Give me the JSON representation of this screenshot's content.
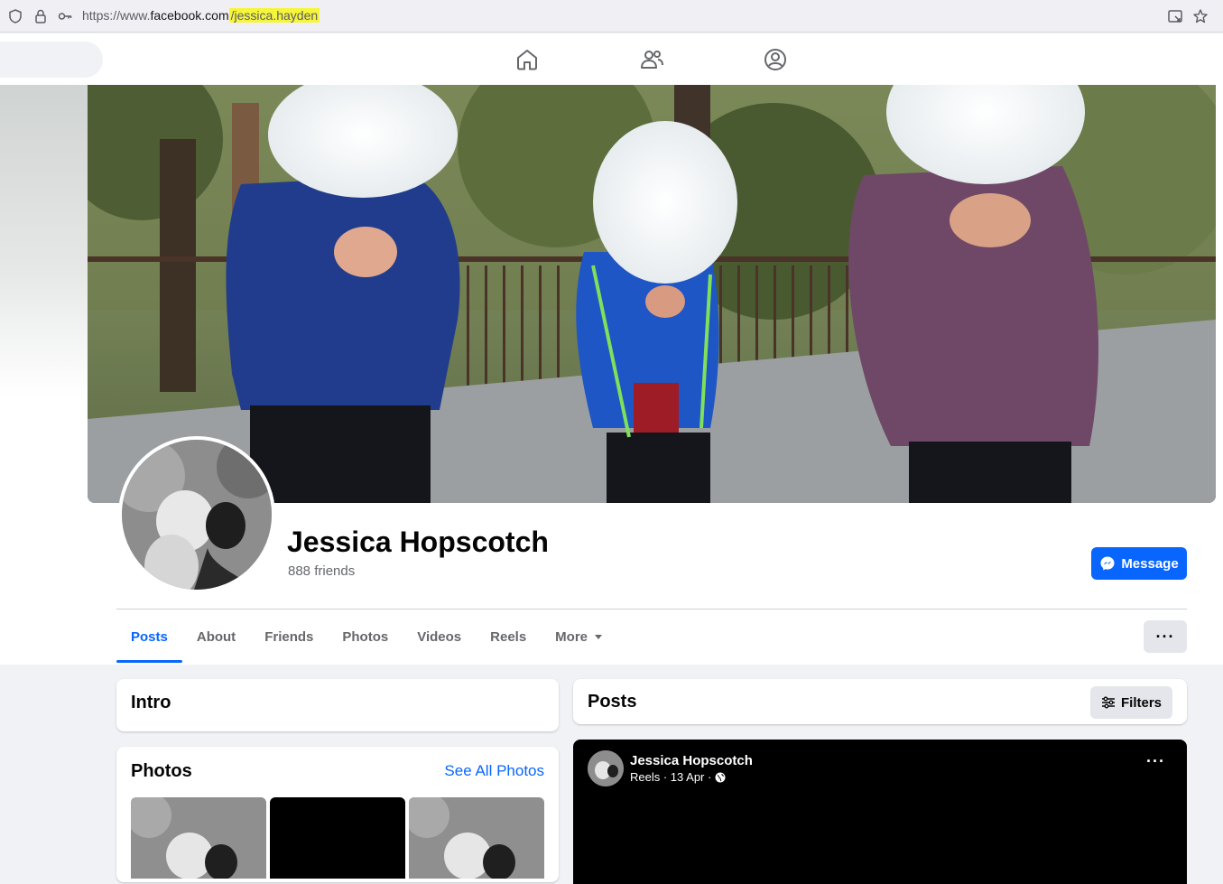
{
  "browser": {
    "url_scheme": "https://www.",
    "url_domain": "facebook.com",
    "url_path": "/jessica.hayden"
  },
  "nav": {
    "icons": [
      "home-icon",
      "friends-icon",
      "profile-icon"
    ]
  },
  "profile": {
    "name": "Jessica Hopscotch",
    "friends": "888 friends",
    "message_label": "Message"
  },
  "tabs": [
    {
      "label": "Posts",
      "active": true
    },
    {
      "label": "About"
    },
    {
      "label": "Friends"
    },
    {
      "label": "Photos"
    },
    {
      "label": "Videos"
    },
    {
      "label": "Reels"
    },
    {
      "label": "More"
    }
  ],
  "more_options_label": "···",
  "intro": {
    "title": "Intro"
  },
  "photos": {
    "title": "Photos",
    "see_all": "See All Photos"
  },
  "posts": {
    "title": "Posts",
    "filters_label": "Filters"
  },
  "post": {
    "author": "Jessica Hopscotch",
    "meta": "Reels · 13 Apr ·",
    "options_label": "···"
  },
  "colors": {
    "accent": "#0866ff",
    "highlight": "#f5f53a",
    "secondary_text": "#65676b"
  }
}
